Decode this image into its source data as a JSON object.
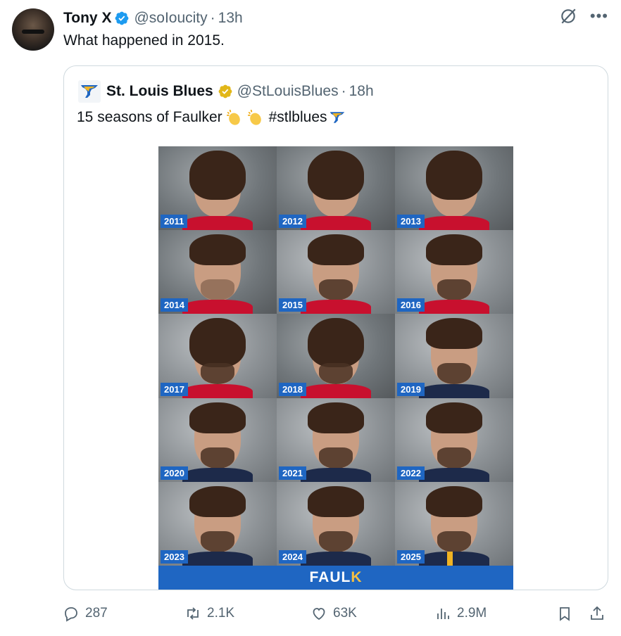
{
  "tweet": {
    "author_name": "Tony X",
    "handle": "@soIoucity",
    "separator": "·",
    "time": "13h",
    "text": "What happened in 2015."
  },
  "quote": {
    "author_name": "St. Louis Blues",
    "handle": "@StLouisBlues",
    "separator": "·",
    "time": "18h",
    "text": "15 seasons of Faulker",
    "hashtag": "#stlblues",
    "years": [
      "2011",
      "2012",
      "2013",
      "2014",
      "2015",
      "2016",
      "2017",
      "2018",
      "2019",
      "2020",
      "2021",
      "2022",
      "2023",
      "2024",
      "2025"
    ],
    "banner_main": "FAUL",
    "banner_accent": "K"
  },
  "actions": {
    "replies": "287",
    "reposts": "2.1K",
    "likes": "63K",
    "views": "2.9M"
  },
  "colors": {
    "accent_blue": "#1f66c2",
    "verified_blue": "#1d9bf0",
    "verified_gold": "#e2b719",
    "muted_text": "#536471"
  },
  "icons": {
    "reply": "speech-bubble-icon",
    "repost": "repost-arrows-icon",
    "like": "heart-icon",
    "views": "bar-chart-icon",
    "bookmark": "bookmark-icon",
    "share": "share-upload-icon",
    "grok": "grok-slash-icon",
    "more": "more-dots-icon"
  }
}
